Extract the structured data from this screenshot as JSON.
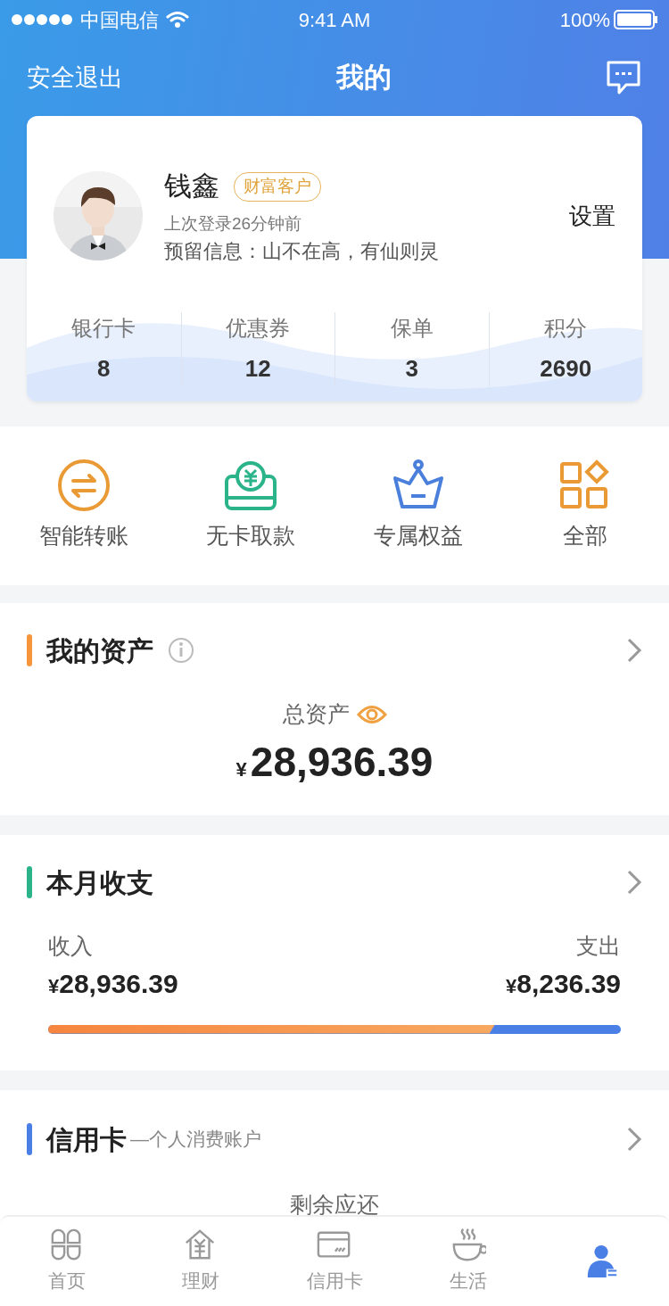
{
  "status_bar": {
    "carrier": "中国电信",
    "time": "9:41 AM",
    "battery": "100%"
  },
  "nav": {
    "left": "安全退出",
    "title": "我的"
  },
  "profile": {
    "name": "钱鑫",
    "badge": "财富客户",
    "last_login": "上次登录26分钟前",
    "note": "预留信息：山不在高，有仙则灵",
    "settings": "设置"
  },
  "stats": [
    {
      "label": "银行卡",
      "value": "8"
    },
    {
      "label": "优惠券",
      "value": "12"
    },
    {
      "label": "保单",
      "value": "3"
    },
    {
      "label": "积分",
      "value": "2690"
    }
  ],
  "shortcuts": [
    {
      "label": "智能转账",
      "kind": "transfer"
    },
    {
      "label": "无卡取款",
      "kind": "withdraw"
    },
    {
      "label": "专属权益",
      "kind": "crown"
    },
    {
      "label": "全部",
      "kind": "grid"
    }
  ],
  "assets": {
    "title": "我的资产",
    "caption": "总资产",
    "currency": "¥",
    "amount": "28,936.39"
  },
  "monthly": {
    "title": "本月收支",
    "income_label": "收入",
    "income_currency": "¥",
    "income": "28,936.39",
    "expense_label": "支出",
    "expense_currency": "¥",
    "expense": "8,236.39",
    "level": 0.78
  },
  "credit": {
    "title": "信用卡",
    "subtitle": "—个人消费账户",
    "caption": "剩余应还"
  },
  "tabs": [
    {
      "label": "首页",
      "kind": "home",
      "selected": false
    },
    {
      "label": "理财",
      "kind": "finance",
      "selected": false
    },
    {
      "label": "信用卡",
      "kind": "card",
      "selected": false
    },
    {
      "label": "生活",
      "kind": "life",
      "selected": false
    },
    {
      "kind": "me",
      "selected": true
    }
  ]
}
